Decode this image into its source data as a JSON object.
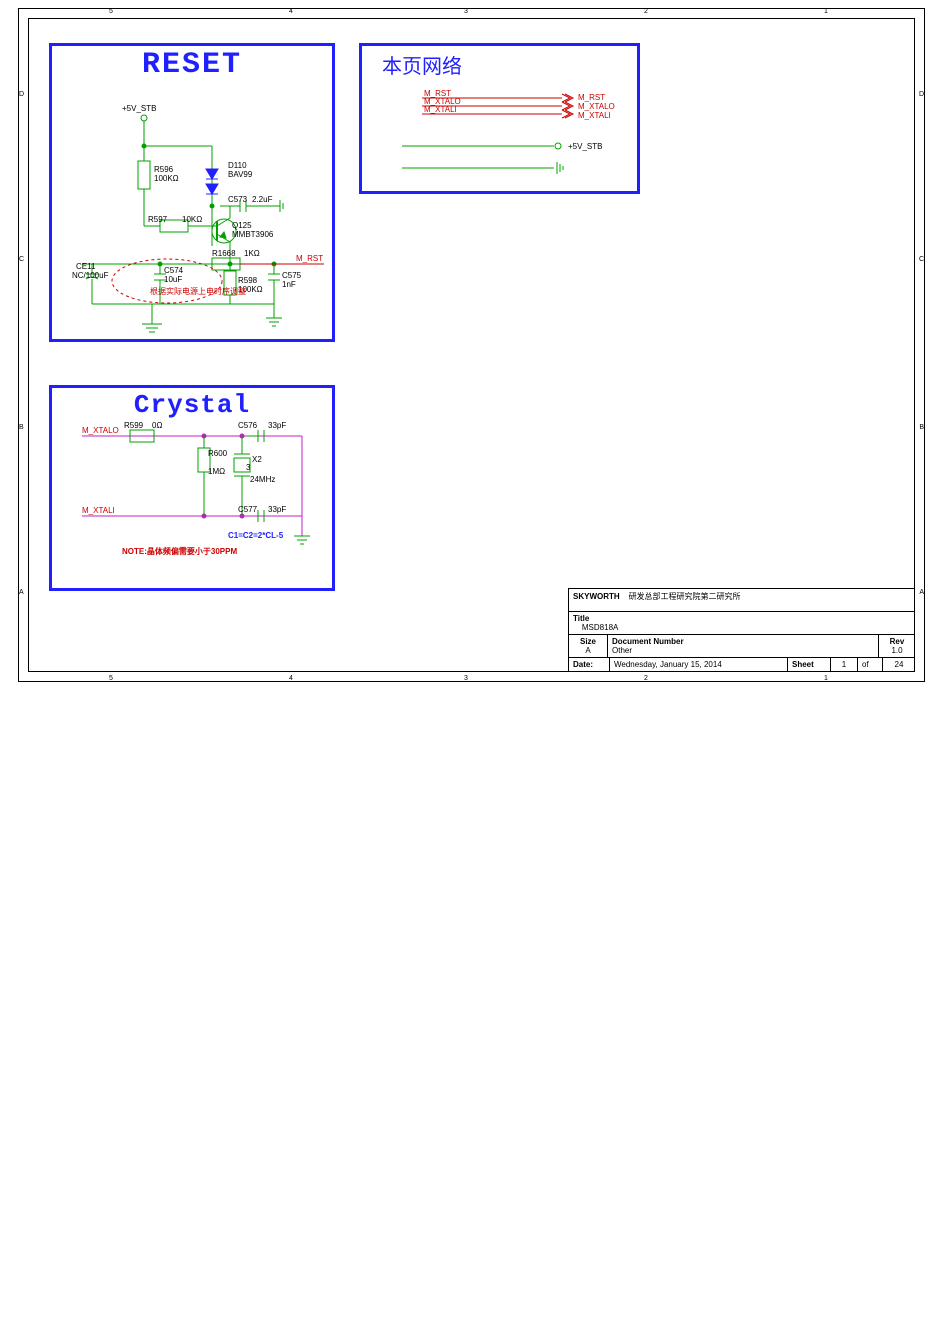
{
  "frame": {
    "cols": [
      "5",
      "4",
      "3",
      "2",
      "1"
    ],
    "rows": [
      "D",
      "C",
      "B",
      "A"
    ]
  },
  "reset": {
    "title": "RESET",
    "power": "+5V_STB",
    "R596": {
      "ref": "R596",
      "val": "100KΩ"
    },
    "D110": {
      "ref": "D110",
      "val": "BAV99"
    },
    "C573": {
      "ref": "C573",
      "val": "2.2uF"
    },
    "R597": {
      "ref": "R597",
      "val": "10KΩ"
    },
    "Q125": {
      "ref": "Q125",
      "val": "MMBT3906"
    },
    "CE11": {
      "ref": "CE11",
      "val": "NC/100uF"
    },
    "C574": {
      "ref": "C574",
      "val": "10uF"
    },
    "R1668": {
      "ref": "R1668",
      "val": "1KΩ"
    },
    "R598": {
      "ref": "R598",
      "val": "100KΩ"
    },
    "C575": {
      "ref": "C575",
      "val": "1nF"
    },
    "net_out": "M_RST",
    "note": "根据实际电源上电时序调整"
  },
  "crystal": {
    "title": "Crystal",
    "M_XTALO": "M_XTALO",
    "M_XTALI": "M_XTALI",
    "R599": {
      "ref": "R599",
      "val": "0Ω"
    },
    "R600": {
      "ref": "R600",
      "val": "1MΩ"
    },
    "C576": {
      "ref": "C576",
      "val": "33pF"
    },
    "C577": {
      "ref": "C577",
      "val": "33pF"
    },
    "X2": {
      "ref": "X2",
      "val": "24MHz",
      "pin": "3"
    },
    "eq": "C1=C2=2*CL-5",
    "note": "NOTE:晶体频偏需要小于30PPM"
  },
  "netblock": {
    "title": "本页网络",
    "left": [
      "M_RST",
      "M_XTALO",
      "M_XTALI"
    ],
    "right": [
      "M_RST",
      "M_XTALO",
      "M_XTALI"
    ],
    "pwr": "+5V_STB"
  },
  "titleblock": {
    "company": "SKYWORTH",
    "company2": "研发总部工程研究院第二研究所",
    "title_lab": "Title",
    "title": "MSD818A",
    "size_lab": "Size",
    "size": "A",
    "docnum_lab": "Document Number",
    "docnum": "Other",
    "rev_lab": "Rev",
    "rev": "1.0",
    "date_lab": "Date:",
    "date": "Wednesday, January 15, 2014",
    "sheet_lab": "Sheet",
    "sheet": "1",
    "of_lab": "of",
    "total": "24"
  }
}
